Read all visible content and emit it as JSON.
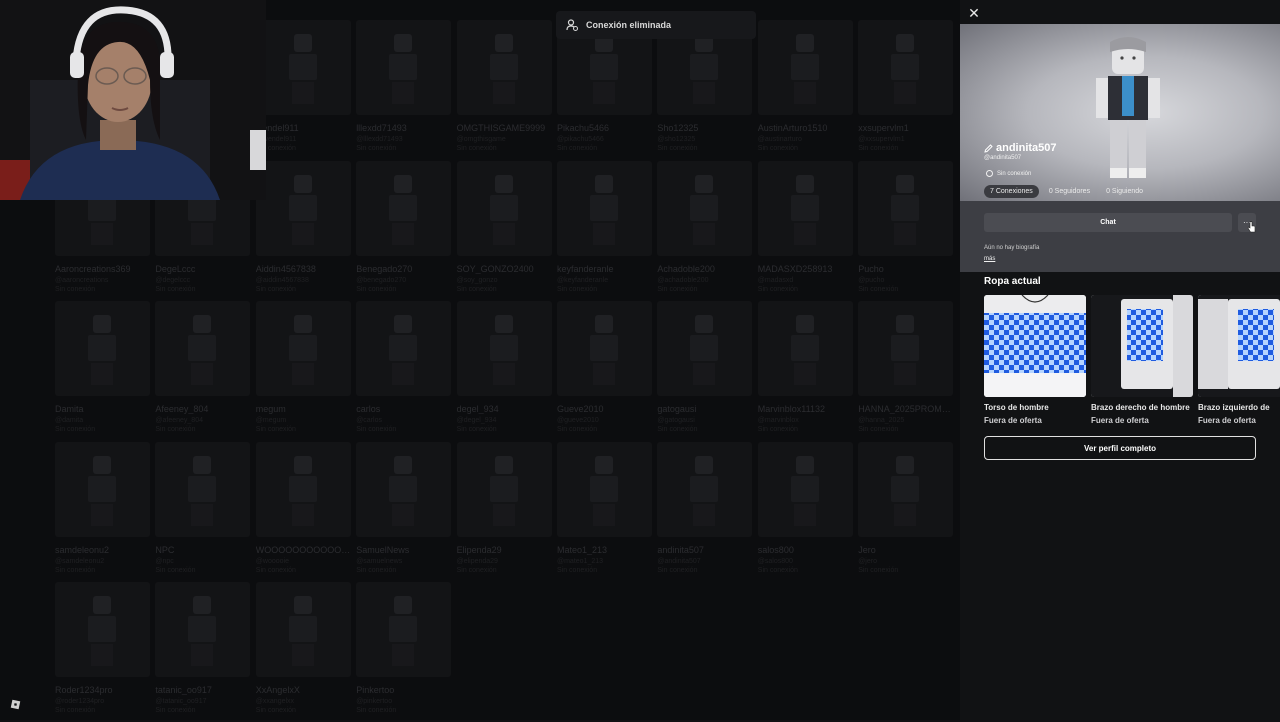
{
  "toast": {
    "text": "Conexión eliminada",
    "icon": "user-removed-icon"
  },
  "grid": {
    "users": [
      {
        "name": "wendel911",
        "line1": "@wendel911",
        "line2": "Sin conexión"
      },
      {
        "name": "lllexdd71493",
        "line1": "@lllexdd71493",
        "line2": "Sin conexión"
      },
      {
        "name": "OMGTHISGAME9999",
        "line1": "@omgthisgame",
        "line2": "Sin conexión"
      },
      {
        "name": "Pikachu5466",
        "line1": "@pikachu5466",
        "line2": "Sin conexión"
      },
      {
        "name": "Sho12325",
        "line1": "@sho12325",
        "line2": "Sin conexión"
      },
      {
        "name": "AustinArturo1510",
        "line1": "@austinarturo",
        "line2": "Sin conexión"
      },
      {
        "name": "xxsupervlm1",
        "line1": "@xxsupervlm1",
        "line2": "Sin conexión"
      },
      {
        "name": "Aaroncreations369",
        "line1": "@aaroncreations",
        "line2": "Sin conexión"
      },
      {
        "name": "DegeLccc",
        "line1": "@degelccc",
        "line2": "Sin conexión"
      },
      {
        "name": "Aiddin4567838",
        "line1": "@aiddin4567838",
        "line2": "Sin conexión"
      },
      {
        "name": "Benegado270",
        "line1": "@benegado270",
        "line2": "Sin conexión"
      },
      {
        "name": "SOY_GONZO2400",
        "line1": "@soy_gonzo",
        "line2": "Sin conexión"
      },
      {
        "name": "keyfanderanle",
        "line1": "@keyfanderanle",
        "line2": "Sin conexión"
      },
      {
        "name": "Achadoble200",
        "line1": "@achadoble200",
        "line2": "Sin conexión"
      },
      {
        "name": "MADASXD258913",
        "line1": "@madasxd",
        "line2": "Sin conexión"
      },
      {
        "name": "Pucho",
        "line1": "@pucho",
        "line2": "Sin conexión"
      },
      {
        "name": "Damita",
        "line1": "@damita",
        "line2": "Sin conexión"
      },
      {
        "name": "Afeeney_804",
        "line1": "@afeeney_804",
        "line2": "Sin conexión"
      },
      {
        "name": "megum",
        "line1": "@megum",
        "line2": "Sin conexión"
      },
      {
        "name": "carlos",
        "line1": "@carlos",
        "line2": "Sin conexión"
      },
      {
        "name": "degel_934",
        "line1": "@degel_934",
        "line2": "Sin conexión"
      },
      {
        "name": "Gueve2010",
        "line1": "@gueve2010",
        "line2": "Sin conexión"
      },
      {
        "name": "gatogausi",
        "line1": "@gatogausi",
        "line2": "Sin conexión"
      },
      {
        "name": "Marvinblox11132",
        "line1": "@marvinblox",
        "line2": "Sin conexión"
      },
      {
        "name": "HANNA_2025PROMAX",
        "line1": "@hanna_2025",
        "line2": "Sin conexión"
      },
      {
        "name": "samdeleonu2",
        "line1": "@samdeleonu2",
        "line2": "Sin conexión"
      },
      {
        "name": "NPC",
        "line1": "@npc",
        "line2": "Sin conexión"
      },
      {
        "name": "WOOOOOOOOOOOOIE",
        "line1": "@wooooie",
        "line2": "Sin conexión"
      },
      {
        "name": "SamuelNews",
        "line1": "@samuelnews",
        "line2": "Sin conexión"
      },
      {
        "name": "Elipenda29",
        "line1": "@elipenda29",
        "line2": "Sin conexión"
      },
      {
        "name": "Mateo1_213",
        "line1": "@mateo1_213",
        "line2": "Sin conexión"
      },
      {
        "name": "andinita507",
        "line1": "@andinita507",
        "line2": "Sin conexión"
      },
      {
        "name": "salos800",
        "line1": "@salos800",
        "line2": "Sin conexión"
      },
      {
        "name": "Jero",
        "line1": "@jero",
        "line2": "Sin conexión"
      },
      {
        "name": "Roder1234pro",
        "line1": "@roder1234pro",
        "line2": "Sin conexión"
      },
      {
        "name": "tatanic_oo917",
        "line1": "@tatanic_oo917",
        "line2": "Sin conexión"
      },
      {
        "name": "XxAngelxX",
        "line1": "@xxangelxx",
        "line2": "Sin conexión"
      },
      {
        "name": "Pinkertoo",
        "line1": "@pinkertoo",
        "line2": "Sin conexión"
      }
    ]
  },
  "profile": {
    "display_name": "andinita507",
    "handle": "@andinita507",
    "status": "Sin conexión",
    "stats": [
      {
        "label": "7 Conexiones"
      },
      {
        "label": "0 Seguidores"
      },
      {
        "label": "0 Siguiendo"
      }
    ],
    "chat_label": "Chat",
    "more_label": "···",
    "bio": "Aún no hay biografía",
    "more_link": "más",
    "outfit_title": "Ropa actual",
    "items": [
      {
        "name": "Torso de hombre",
        "status": "Fuera de oferta"
      },
      {
        "name": "Brazo derecho de hombre",
        "status": "Fuera de oferta"
      },
      {
        "name": "Brazo izquierdo de",
        "status": "Fuera de oferta"
      }
    ],
    "full_profile_label": "Ver perfil completo",
    "close_label": "✕"
  },
  "colors": {
    "panel_bg": "#111214",
    "actions_bg": "#3d3e44",
    "checker_blue": "#1f5be0"
  }
}
